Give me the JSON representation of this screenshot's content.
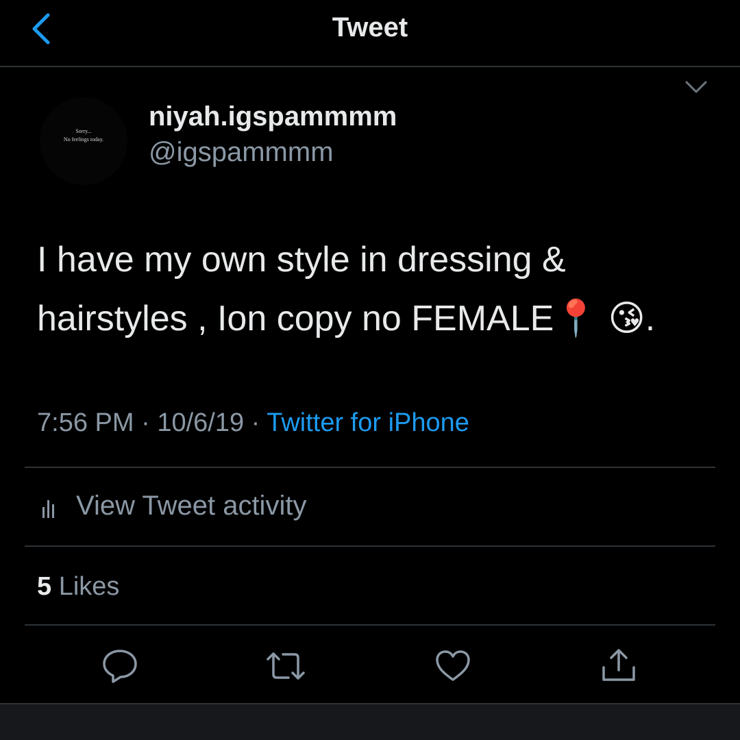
{
  "nav": {
    "title": "Tweet",
    "back_icon": "chevron-left-icon",
    "accent_color": "#1d9bf0"
  },
  "tweet": {
    "avatar": {
      "line1": "Sorry...",
      "line2": "No feelings today."
    },
    "display_name": "niyah.igspammmm",
    "handle": "@igspammmm",
    "text_line1": "I have my own style in dressing &",
    "text_line2": "hairstyles , Ion copy no FEMALE",
    "text_emojis": "📍 😘",
    "text_end": ".",
    "time": "7:56 PM",
    "separator": "·",
    "date": "10/6/19",
    "source": "Twitter for iPhone",
    "options_icon": "chevron-down-icon"
  },
  "activity": {
    "label": "View Tweet activity",
    "icon": "bar-chart-icon"
  },
  "likes": {
    "count": "5",
    "label": "Likes"
  },
  "actions": {
    "reply_icon": "reply-icon",
    "retweet_icon": "retweet-icon",
    "like_icon": "heart-icon",
    "share_icon": "share-icon"
  },
  "colors": {
    "background": "#000000",
    "primary_text": "#e7e9ea",
    "secondary_text": "#8b98a5",
    "divider": "#2f3336",
    "link": "#1d9bf0"
  }
}
